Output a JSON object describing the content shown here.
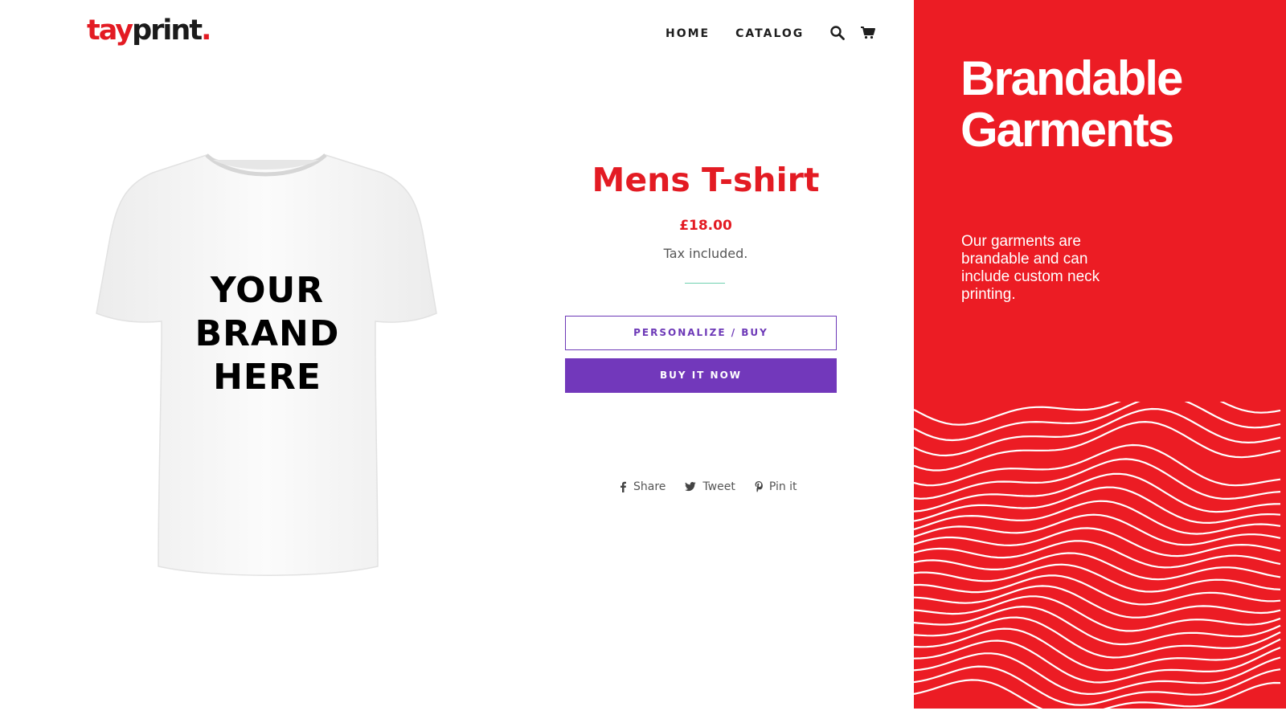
{
  "header": {
    "logo_part1": "tay",
    "logo_part2": "print",
    "logo_dot": ".",
    "nav": {
      "home_label": "HOME",
      "catalog_label": "CATALOG"
    },
    "icons": [
      "search-icon",
      "cart-icon"
    ]
  },
  "product": {
    "image_print_lines": [
      "YOUR",
      "BRAND",
      "HERE"
    ],
    "title": "Mens T-shirt",
    "price": "£18.00",
    "tax_note": "Tax included.",
    "personalize_label": "PERSONALIZE / BUY",
    "buy_now_label": "BUY IT NOW"
  },
  "share": {
    "facebook_label": "Share",
    "twitter_label": "Tweet",
    "pinterest_label": "Pin it"
  },
  "promo": {
    "title_line1": "Brandable",
    "title_line2": "Garments",
    "text": "Our garments are brandable and can include custom neck printing."
  },
  "colors": {
    "brand_red": "#ec1c24",
    "accent_purple": "#7238bb",
    "divider_teal": "#6fd1b0"
  }
}
